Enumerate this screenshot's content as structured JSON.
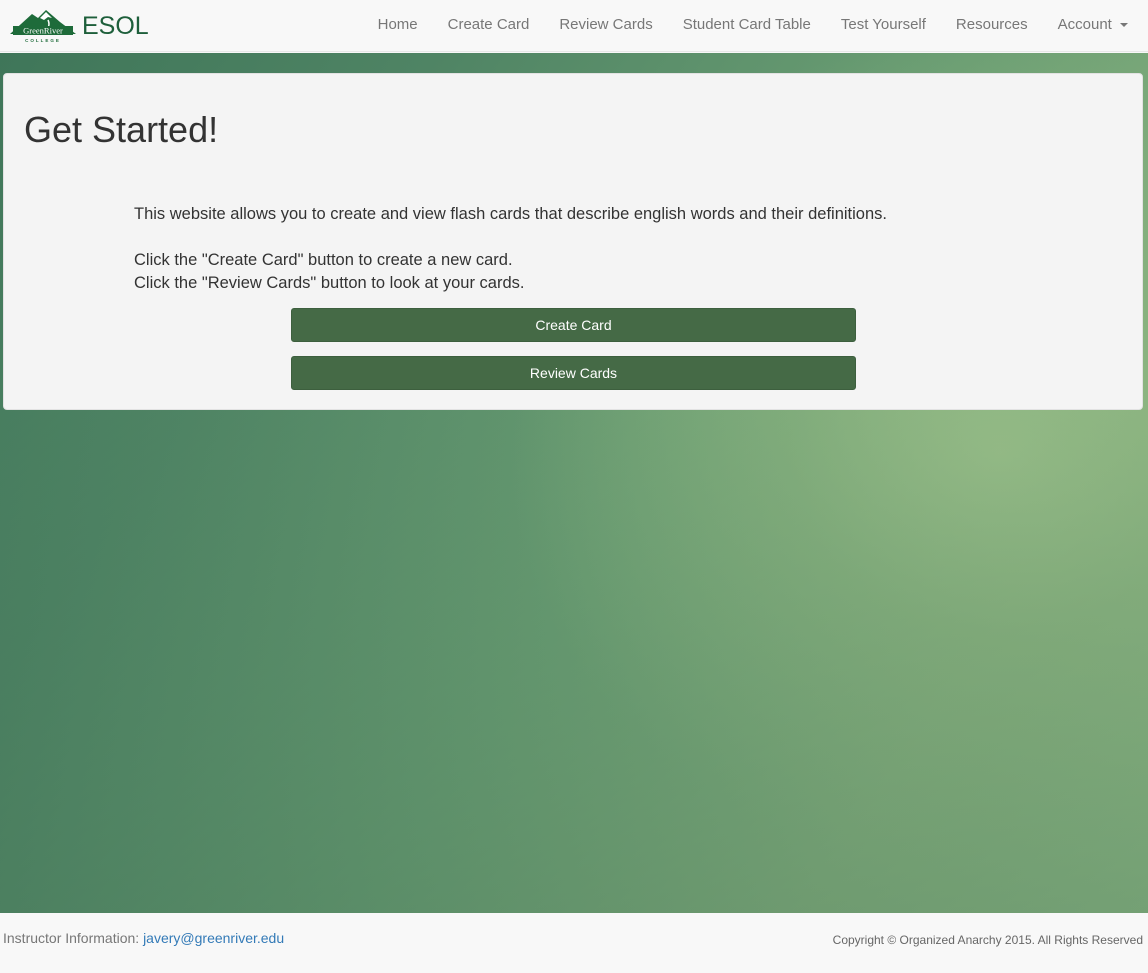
{
  "navbar": {
    "brand": {
      "logo_alt": "Green River College",
      "logo_line1": "GreenRiver",
      "logo_line2": "COLLEGE",
      "title": "ESOL"
    },
    "items": [
      {
        "label": "Home"
      },
      {
        "label": "Create Card"
      },
      {
        "label": "Review Cards"
      },
      {
        "label": "Student Card Table"
      },
      {
        "label": "Test Yourself"
      },
      {
        "label": "Resources"
      },
      {
        "label": "Account",
        "icon": "caret-down-icon"
      }
    ]
  },
  "main": {
    "title": "Get Started!",
    "description": "This website allows you to create and view flash cards that describe english words and their definitions.",
    "instructions": [
      "Click the \"Create Card\" button to create a new card.",
      "Click the \"Review Cards\" button to look at your cards."
    ],
    "buttons": {
      "create": "Create Card",
      "review": "Review Cards"
    }
  },
  "footer": {
    "instructor_label": "Instructor Information: ",
    "instructor_email": "javery@greenriver.edu",
    "copyright": "Copyright © Organized Anarchy 2015. All Rights Reserved"
  },
  "colors": {
    "brand_green": "#1e5f3b",
    "button_green": "#456a46",
    "link_blue": "#337ab7",
    "nav_text": "#777777"
  }
}
